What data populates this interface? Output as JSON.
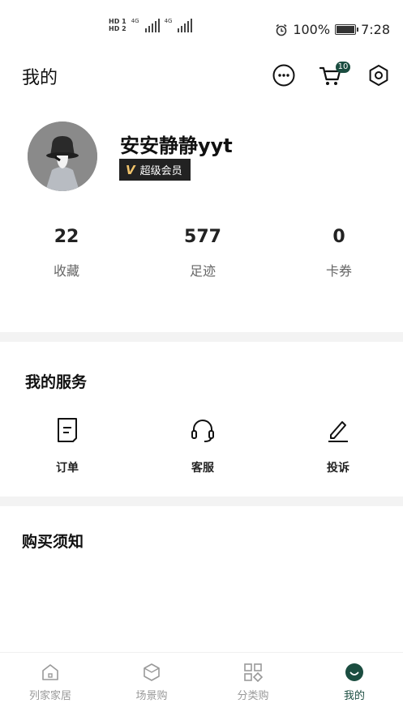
{
  "status_bar": {
    "sim1": "HD 1",
    "sim2": "HD 2",
    "network1": "4G",
    "network2": "4G",
    "battery": "100%",
    "time": "7:28"
  },
  "header": {
    "title": "我的",
    "cart_count": "10"
  },
  "profile": {
    "username": "安安静静yyt",
    "vip_label": "超级会员",
    "vip_icon": "V"
  },
  "stats": [
    {
      "value": "22",
      "label": "收藏"
    },
    {
      "value": "577",
      "label": "足迹"
    },
    {
      "value": "0",
      "label": "卡券"
    }
  ],
  "services": {
    "title": "我的服务",
    "items": [
      {
        "label": "订单",
        "icon": "order-icon"
      },
      {
        "label": "客服",
        "icon": "headset-icon"
      },
      {
        "label": "投诉",
        "icon": "edit-icon"
      }
    ]
  },
  "notice": {
    "title": "购买须知"
  },
  "tabbar": {
    "active_color": "#1b4d40",
    "inactive_color": "#999999",
    "items": [
      {
        "label": "列家家居",
        "icon": "home-icon"
      },
      {
        "label": "场景购",
        "icon": "box-icon"
      },
      {
        "label": "分类购",
        "icon": "category-icon"
      },
      {
        "label": "我的",
        "icon": "profile-icon"
      }
    ]
  }
}
